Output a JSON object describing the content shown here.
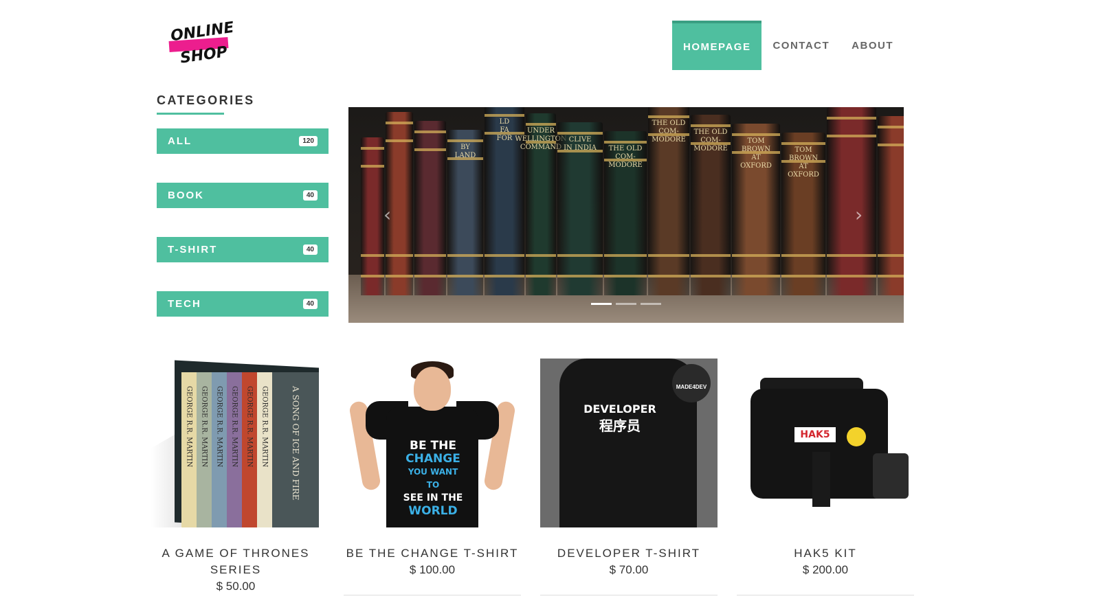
{
  "logo": {
    "line1": "ONLINE",
    "line2": "SHOP"
  },
  "nav": [
    {
      "label": "HOMEPAGE",
      "active": true
    },
    {
      "label": "CONTACT",
      "active": false
    },
    {
      "label": "ABOUT",
      "active": false
    }
  ],
  "categories": {
    "title": "CATEGORIES",
    "items": [
      {
        "label": "ALL",
        "count": "120"
      },
      {
        "label": "BOOK",
        "count": "40"
      },
      {
        "label": "T-SHIRT",
        "count": "40"
      },
      {
        "label": "TECH",
        "count": "40"
      }
    ]
  },
  "carousel": {
    "prev_icon": "chevron-left-icon",
    "next_icon": "chevron-right-icon",
    "slide_count": 3,
    "active_slide": 1,
    "spine_labels": [
      "BY\nLAND",
      "LD\nFA\nFOR",
      "UNDER\nWELLINGTON\nCOMMAND",
      "CLIVE\nIN INDIA",
      "THE OLD\nCOM-\nMODORE",
      "THE OLD\nCOM-\nMODORE",
      "THE OLD\nCOM-\nMODORE",
      "TOM\nBROWN\nAT\nOXFORD",
      "TOM\nBROWN\nAT\nOXFORD"
    ]
  },
  "products": [
    {
      "name": "A GAME OF THRONES SERIES",
      "price": "$ 50.00",
      "art": {
        "box_author": "GEORGE R.R. MARTIN",
        "box_title": "A SONG OF ICE AND FIRE"
      }
    },
    {
      "name": "BE THE CHANGE T-SHIRT",
      "price": "$ 100.00",
      "art": {
        "print_lines": [
          "BE THE",
          "CHANGE",
          "YOU WANT TO",
          "SEE IN THE",
          "WORLD"
        ]
      }
    },
    {
      "name": "DEVELOPER T-SHIRT",
      "price": "$ 70.00",
      "art": {
        "print_lines": [
          "DEVELOPER",
          "程序员"
        ],
        "badge": "MADE4DEV"
      }
    },
    {
      "name": "HAK5 KIT",
      "price": "$ 200.00",
      "art": {
        "logo": "HAK5"
      }
    }
  ],
  "colors": {
    "accent": "#4fbf9f",
    "logo_pink": "#ec1e8e"
  }
}
